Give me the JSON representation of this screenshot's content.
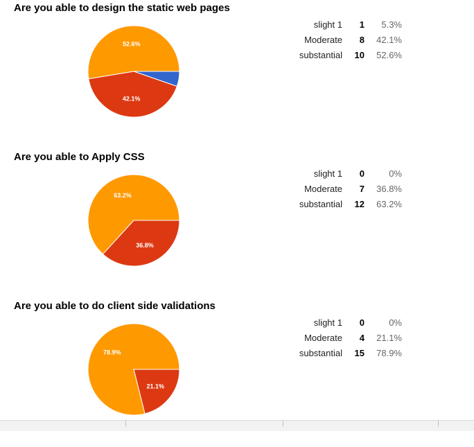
{
  "colors": {
    "slight": "#3366cc",
    "moderate": "#dc3912",
    "substantial": "#ff9900",
    "slice_label": "#ffffff"
  },
  "chart_data": [
    {
      "type": "pie",
      "title": "Are you able to design the static web pages",
      "categories": [
        "slight 1",
        "Moderate",
        "substantial"
      ],
      "counts": [
        1,
        8,
        10
      ],
      "percent_labels": [
        "5.3%",
        "42.1%",
        "52.6%"
      ],
      "values": [
        5.3,
        42.1,
        52.6
      ],
      "slice_labels": [
        "",
        "42.1%",
        "52.6%"
      ]
    },
    {
      "type": "pie",
      "title": "Are you able to Apply CSS",
      "categories": [
        "slight 1",
        "Moderate",
        "substantial"
      ],
      "counts": [
        0,
        7,
        12
      ],
      "percent_labels": [
        "0%",
        "36.8%",
        "63.2%"
      ],
      "values": [
        0,
        36.8,
        63.2
      ],
      "slice_labels": [
        "",
        "36.8%",
        "63.2%"
      ]
    },
    {
      "type": "pie",
      "title": "Are you able to do client side validations",
      "categories": [
        "slight 1",
        "Moderate",
        "substantial"
      ],
      "counts": [
        0,
        4,
        15
      ],
      "percent_labels": [
        "0%",
        "21.1%",
        "78.9%"
      ],
      "values": [
        0,
        21.1,
        78.9
      ],
      "slice_labels": [
        "",
        "21.1%",
        "78.9%"
      ]
    }
  ]
}
